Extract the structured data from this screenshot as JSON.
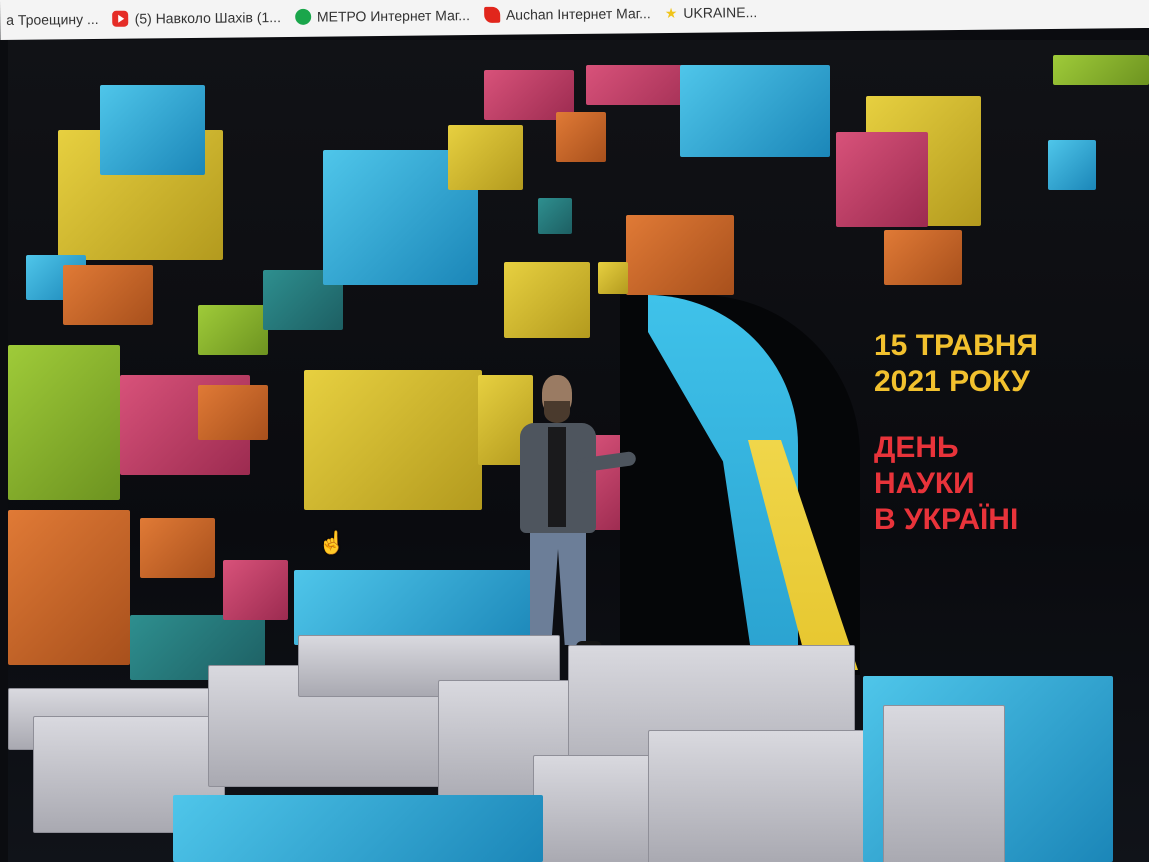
{
  "bookmarks": [
    {
      "label": "а Троещину ...",
      "icon": "none"
    },
    {
      "label": "(5) Навколо Шахів (1...",
      "icon": "youtube-icon"
    },
    {
      "label": "МЕТРО Интернет Маг...",
      "icon": "metro-icon"
    },
    {
      "label": "Auchan Інтернет Маг...",
      "icon": "auchan-icon"
    },
    {
      "label": "UKRAINE...",
      "icon": "star-icon"
    }
  ],
  "event": {
    "date_line1": "15 ТРАВНЯ",
    "date_line2": "2021 РОКУ",
    "title_line1": "ДЕНЬ",
    "title_line2": "НАУКИ",
    "title_line3": "В УКРАЇНІ"
  },
  "colors": {
    "date_text": "#f2c12e",
    "title_text": "#e8333a",
    "flag_blue": "#3fc2ea",
    "flag_yellow": "#f0d64a"
  }
}
